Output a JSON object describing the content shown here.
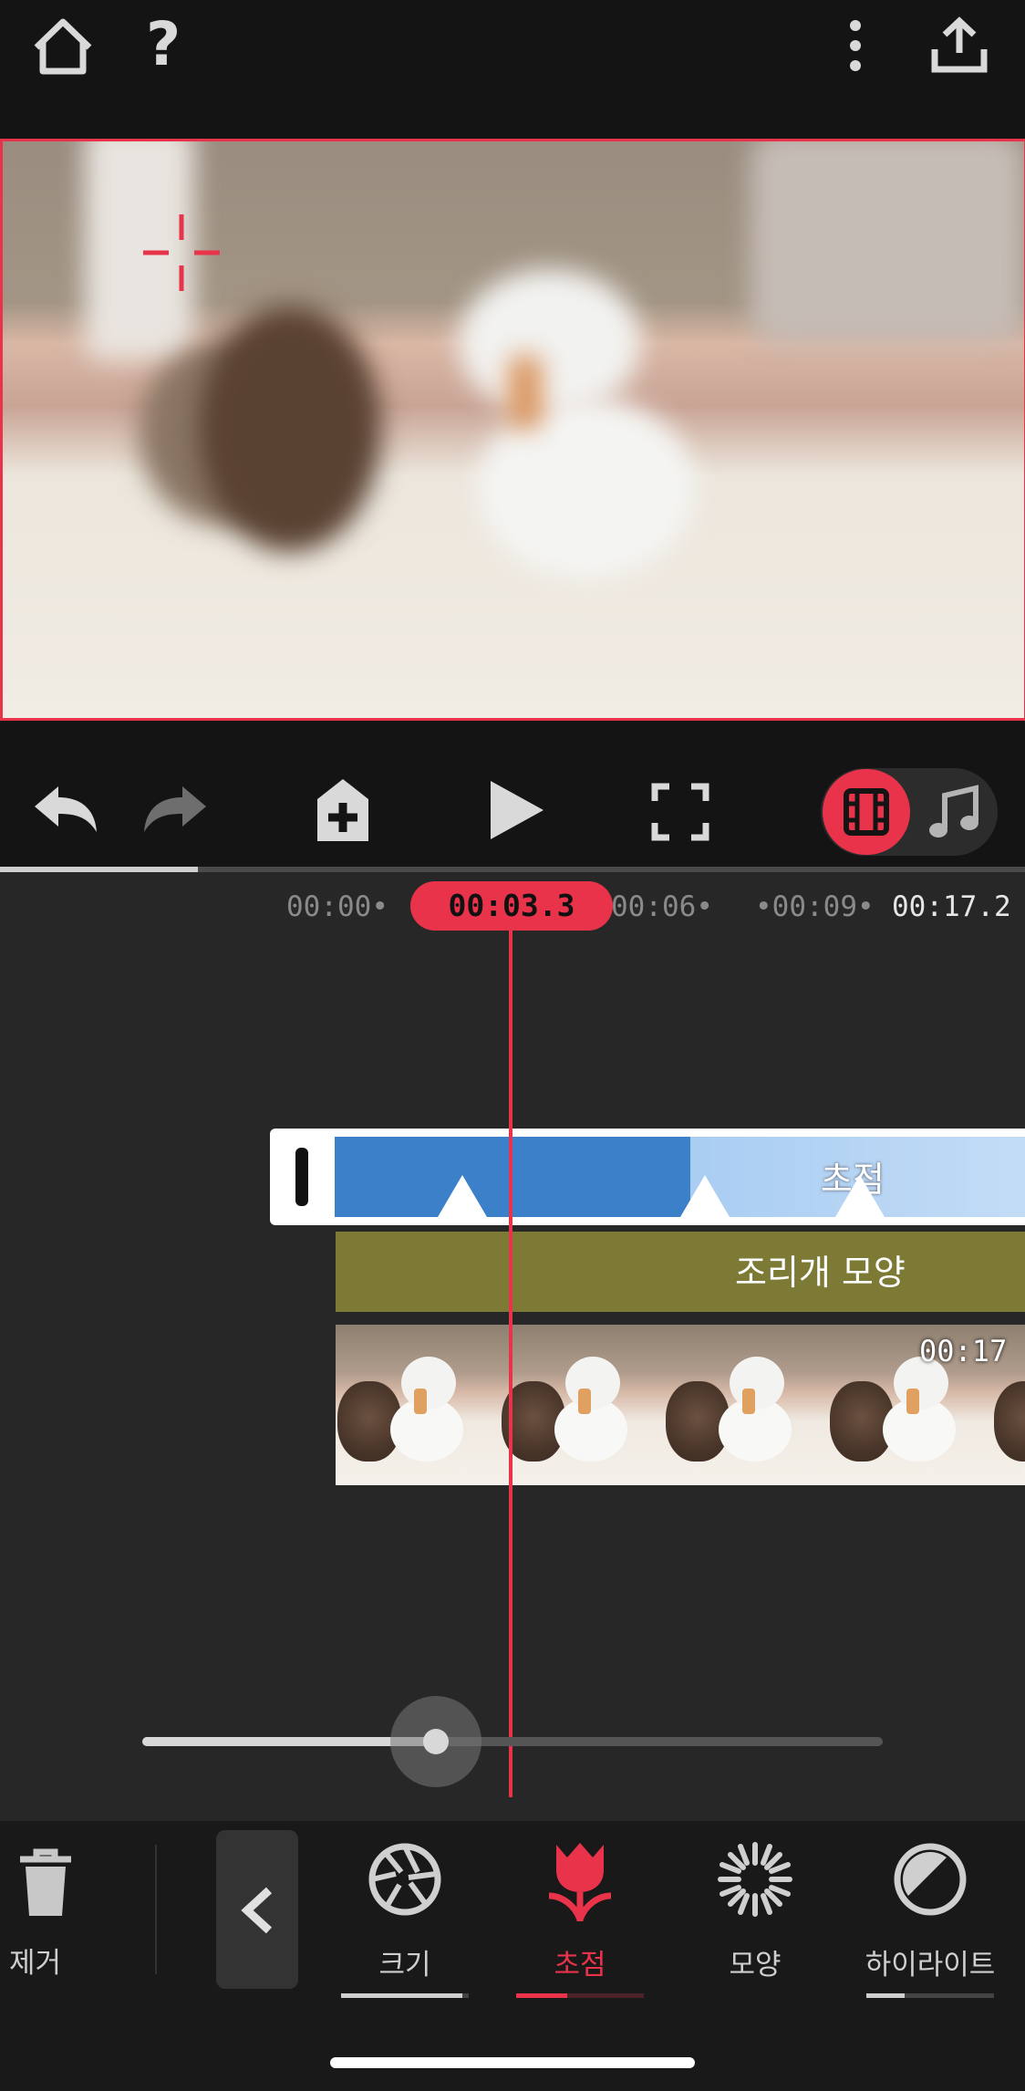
{
  "top_bar": {
    "icons": [
      "home-icon",
      "help-icon",
      "more-vert-icon",
      "share-export-icon"
    ],
    "help_glyph": "?"
  },
  "preview": {
    "focus_target_icon": "crosshair-icon",
    "border_color": "#e8334a"
  },
  "controls": {
    "icons": [
      "undo-icon",
      "redo-icon",
      "add-layer-icon",
      "play-icon",
      "fullscreen-icon",
      "video-mode-icon",
      "audio-mode-icon"
    ],
    "active_mode": "video"
  },
  "progress": {
    "fraction": 0.19
  },
  "timeline": {
    "ticks": [
      "00:00•",
      "00:06•",
      "•00:09•"
    ],
    "current_time": "00:03.3",
    "total_time": "00:17.2",
    "tracks": {
      "focus": {
        "label": "초점",
        "keyframe_count": 3
      },
      "aperture": {
        "label": "조리개 모양"
      },
      "video": {
        "duration": "00:17",
        "thumbnail_count": 5
      }
    }
  },
  "zoom_slider": {
    "fraction": 0.4
  },
  "toolbar": {
    "delete": {
      "label": "제거",
      "icon": "trash-icon"
    },
    "back": {
      "icon": "chevron-left-icon"
    },
    "tools": [
      {
        "label": "크기",
        "icon": "aperture-icon",
        "progress": 0.95,
        "active": false
      },
      {
        "label": "초점",
        "icon": "tulip-macro-icon",
        "progress": 0.4,
        "active": true
      },
      {
        "label": "모양",
        "icon": "starburst-icon",
        "progress": 0,
        "active": false
      },
      {
        "label": "하이라이트",
        "icon": "highlight-circle-icon",
        "progress": 0.3,
        "active": false
      }
    ]
  },
  "colors": {
    "accent": "#e8334a",
    "focus_track": "#3b80c8",
    "aperture_track": "#7d7a35"
  }
}
